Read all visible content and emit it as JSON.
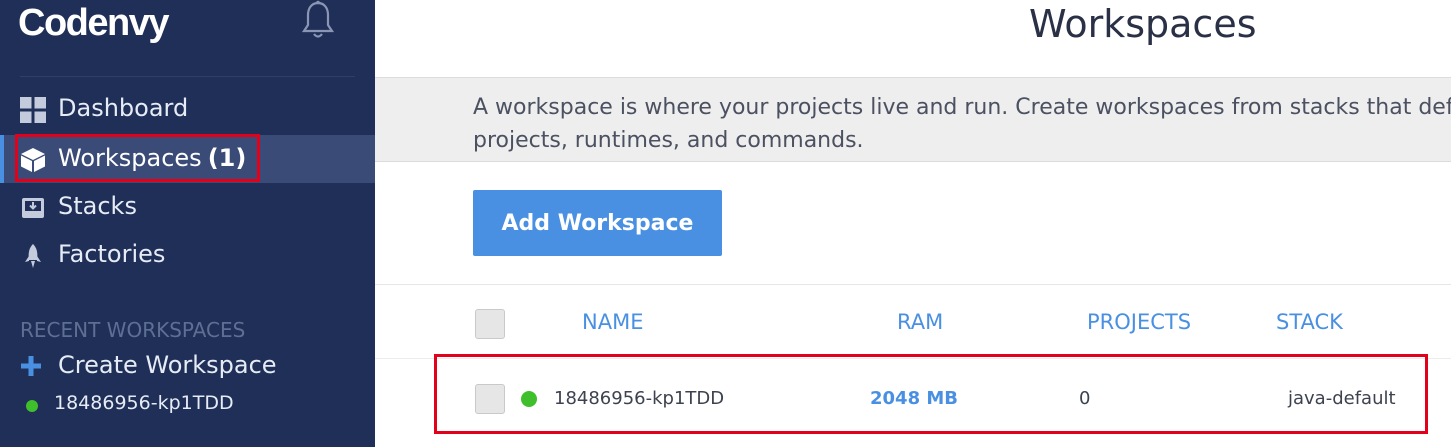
{
  "sidebar": {
    "brand": "Codenvy",
    "nav": [
      {
        "label": "Dashboard",
        "icon": "grid-icon"
      },
      {
        "label": "Workspaces",
        "count": "(1)",
        "icon": "cube-icon",
        "active": true
      },
      {
        "label": "Stacks",
        "icon": "stack-download-icon"
      },
      {
        "label": "Factories",
        "icon": "rocket-icon"
      }
    ],
    "recent_title": "RECENT WORKSPACES",
    "create_label": "Create Workspace",
    "recent_items": [
      {
        "label": "18486956-kp1TDD",
        "status_color": "#3fbf2c"
      }
    ]
  },
  "main": {
    "title": "Workspaces",
    "description": "A workspace is where your projects live and run. Create workspaces from stacks that define projects, runtimes, and commands.",
    "add_button": "Add Workspace",
    "table": {
      "columns": [
        "NAME",
        "RAM",
        "PROJECTS",
        "STACK"
      ],
      "rows": [
        {
          "name": "18486956-kp1TDD",
          "ram": "2048 MB",
          "projects": "0",
          "stack": "java-default",
          "status_color": "#3fbf2c"
        }
      ]
    }
  },
  "colors": {
    "sidebar_bg": "#1f2f58",
    "accent": "#4a90e2",
    "highlight": "#e3001b",
    "running": "#3fbf2c"
  }
}
